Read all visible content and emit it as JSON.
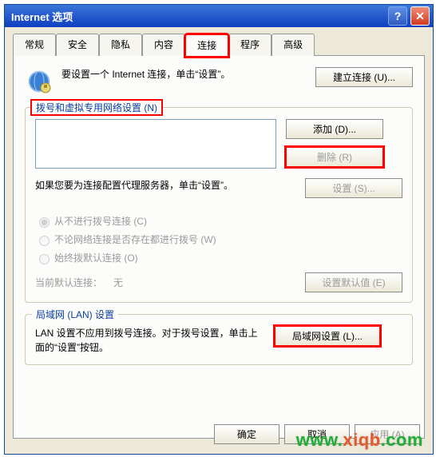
{
  "title": "Internet 选项",
  "tabs": {
    "general": "常规",
    "security": "安全",
    "privacy": "隐私",
    "content": "内容",
    "connections": "连接",
    "programs": "程序",
    "advanced": "高级"
  },
  "intro_text": "要设置一个 Internet 连接，单击“设置”。",
  "btn_setup_connection": "建立连接 (U)...",
  "fieldset1_legend": "拨号和虚拟专用网络设置 (N)",
  "btn_add": "添加 (D)...",
  "btn_delete": "删除 (R)",
  "proxy_text": "如果您要为连接配置代理服务器，单击“设置”。",
  "btn_settings": "设置 (S)...",
  "radio_never": "从不进行拨号连接 (C)",
  "radio_whenever": "不论网络连接是否存在都进行拨号 (W)",
  "radio_always": "始终拨默认连接 (O)",
  "default_label": "当前默认连接：",
  "default_value": "无",
  "btn_set_default": "设置默认值 (E)",
  "fieldset2_legend": "局域网 (LAN) 设置",
  "lan_text": "LAN 设置不应用到拨号连接。对于拨号设置，单击上面的“设置”按钮。",
  "btn_lan_settings": "局域网设置 (L)...",
  "btn_ok": "确定",
  "btn_cancel": "取消",
  "btn_apply": "应用 (A)",
  "watermark_prefix": "www.",
  "watermark_highlight": "xiqb",
  "watermark_suffix": ".com",
  "icons": {
    "help": "?",
    "close": "✕"
  }
}
